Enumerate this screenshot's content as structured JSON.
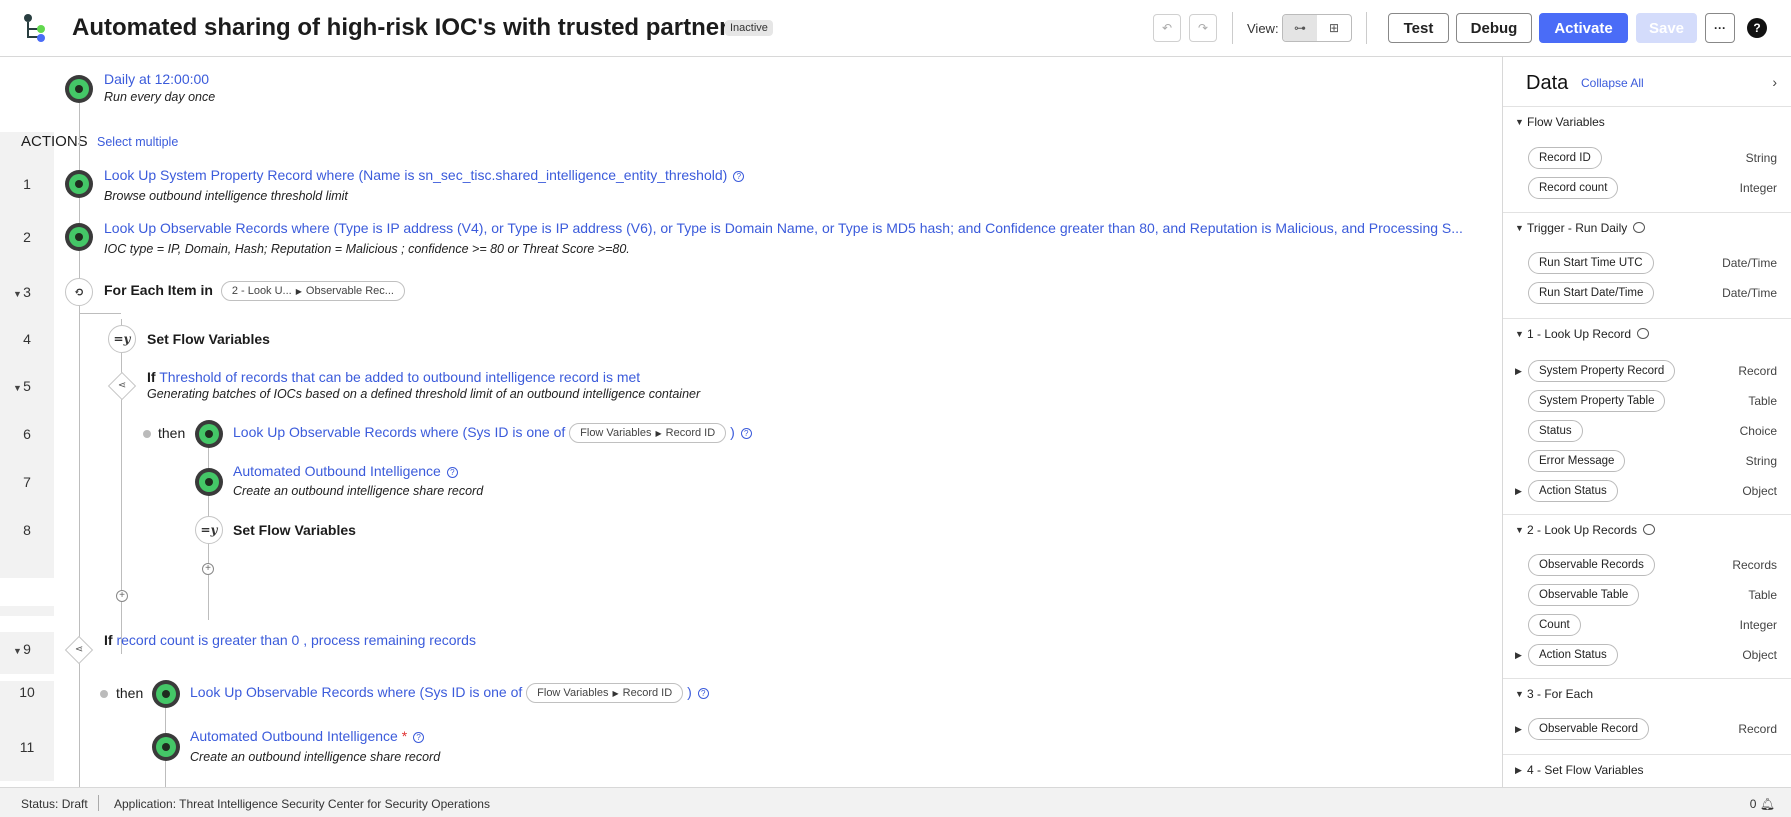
{
  "header": {
    "title": "Automated sharing of high-risk IOC's with trusted partners",
    "status_badge": "Inactive",
    "view_label": "View:",
    "buttons": {
      "test": "Test",
      "debug": "Debug",
      "activate": "Activate",
      "save": "Save",
      "more": "···",
      "help": "?"
    }
  },
  "trigger": {
    "name": "Daily",
    "time": " at 12:00:00",
    "description": "Run every day once"
  },
  "actions_header": {
    "label": "ACTIONS",
    "select_multiple": "Select multiple"
  },
  "steps": {
    "s1": {
      "num": "1",
      "text": "Look Up System Property Record where (Name is sn_sec_tisc.shared_intelligence_entity_threshold)",
      "desc": "Browse outbound intelligence threshold limit"
    },
    "s2": {
      "num": "2",
      "text": "Look Up Observable Records where (Type is IP address (V4), or Type is IP address (V6), or Type is Domain Name, or Type is MD5 hash; and Confidence greater than 80, and Reputation is Malicious, and Processing S...",
      "desc": "IOC type = IP, Domain, Hash; Reputation = Malicious ; confidence >= 80 or Threat Score >=80."
    },
    "s3": {
      "num": "3",
      "label": "For Each Item in",
      "pill_a": "2 - Look U...",
      "pill_b": "Observable Rec..."
    },
    "s4": {
      "num": "4",
      "label": "Set Flow Variables"
    },
    "s5": {
      "num": "5",
      "if": "If",
      "text": "Threshold of records that can be added to outbound intelligence record is met",
      "desc": "Generating batches of IOCs based on a defined threshold limit of an outbound intelligence container"
    },
    "s6": {
      "num": "6",
      "then": "then",
      "text": "Look Up Observable Records where (Sys ID is one of",
      "pill_a": "Flow Variables",
      "pill_b": "Record ID",
      "close": ")"
    },
    "s7": {
      "num": "7",
      "text": "Automated Outbound Intelligence",
      "desc": "Create an outbound intelligence share record"
    },
    "s8": {
      "num": "8",
      "label": "Set Flow Variables"
    },
    "s9": {
      "num": "9",
      "if": "If",
      "text": "record count is greater than 0 , process remaining records"
    },
    "s10": {
      "num": "10",
      "then": "then",
      "text": "Look Up Observable Records where (Sys ID is one of",
      "pill_a": "Flow Variables",
      "pill_b": "Record ID",
      "close": ")"
    },
    "s11": {
      "num": "11",
      "text": "Automated Outbound Intelligence",
      "required": "*",
      "desc": "Create an outbound intelligence share record"
    }
  },
  "panel": {
    "title": "Data",
    "collapse_all": "Collapse All",
    "sections": {
      "flow_vars": {
        "label": "Flow Variables",
        "items": [
          {
            "name": "Record ID",
            "type": "String"
          },
          {
            "name": "Record count",
            "type": "Integer"
          }
        ]
      },
      "trigger": {
        "label": "Trigger - Run Daily",
        "items": [
          {
            "name": "Run Start Time UTC",
            "type": "Date/Time"
          },
          {
            "name": "Run Start Date/Time",
            "type": "Date/Time"
          }
        ]
      },
      "lookup1": {
        "label": "1 - Look Up Record",
        "items": [
          {
            "name": "System Property Record",
            "type": "Record"
          },
          {
            "name": "System Property Table",
            "type": "Table"
          },
          {
            "name": "Status",
            "type": "Choice"
          },
          {
            "name": "Error Message",
            "type": "String"
          },
          {
            "name": "Action Status",
            "type": "Object"
          }
        ]
      },
      "lookup2": {
        "label": "2 - Look Up Records",
        "items": [
          {
            "name": "Observable Records",
            "type": "Records"
          },
          {
            "name": "Observable Table",
            "type": "Table"
          },
          {
            "name": "Count",
            "type": "Integer"
          },
          {
            "name": "Action Status",
            "type": "Object"
          }
        ]
      },
      "foreach": {
        "label": "3 - For Each",
        "items": [
          {
            "name": "Observable Record",
            "type": "Record"
          }
        ]
      },
      "setvars": {
        "label": "4 - Set Flow Variables"
      }
    }
  },
  "statusbar": {
    "status": "Status: Draft",
    "application": "Application: Threat Intelligence Security Center for Security Operations",
    "notifications": "0"
  },
  "colors": {
    "accent": "#4a6cf7",
    "link": "#3b5bdb",
    "node_green": "#44c767"
  },
  "icons": {
    "logo": "flow-logo-icon",
    "undo": "undo-icon",
    "redo": "redo-icon",
    "view_flow": "flow-view-icon",
    "view_grid": "grid-view-icon",
    "bell": "bell-icon"
  }
}
